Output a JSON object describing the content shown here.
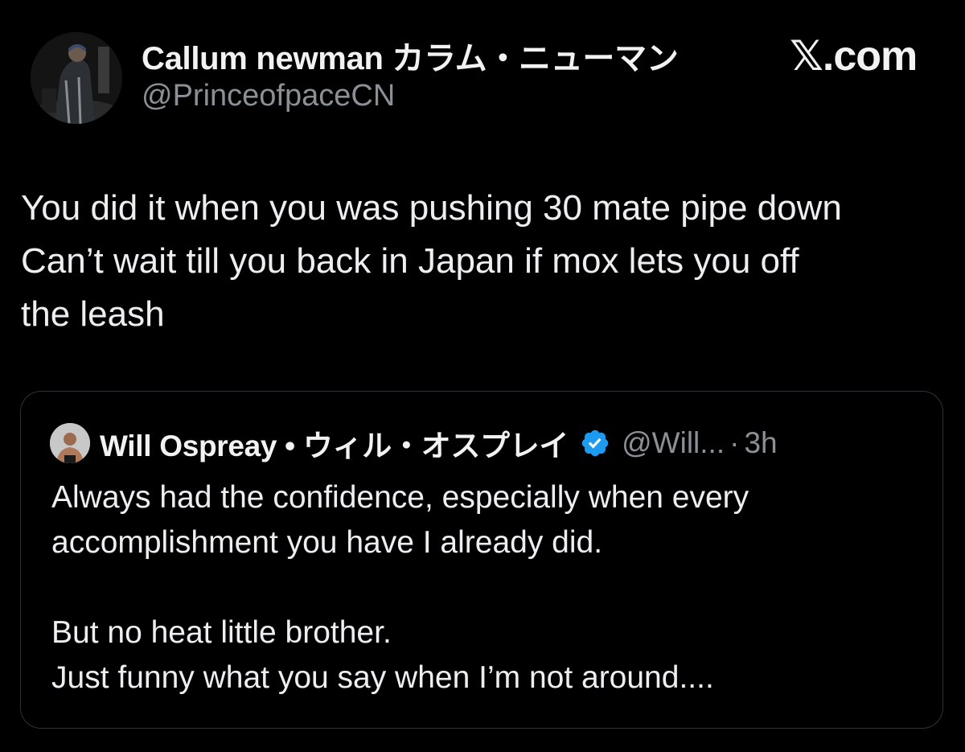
{
  "author": {
    "display_name": "Callum newman カラム・ニューマン",
    "handle": "@PrinceofpaceCN"
  },
  "watermark": {
    "glyph": "𝕏",
    "text": ".com"
  },
  "tweet": {
    "lines": [
      "You did it when you was pushing 30 mate pipe down",
      "Can’t wait till you back in Japan if mox lets you off",
      "the leash"
    ]
  },
  "quoted_tweet": {
    "display_name": "Will Ospreay • ウィル・オスプレイ",
    "verified": true,
    "handle": "@Will...",
    "separator": "·",
    "time": "3h",
    "lines": [
      "Always had the confidence, especially when every",
      "accomplishment you have I already did.",
      "",
      "But no heat little brother.",
      "Just funny what you say when I’m not around...."
    ]
  },
  "colors": {
    "background": "#000000",
    "text_primary": "#e7e9ea",
    "text_secondary": "#8b9096",
    "verified_badge": "#1d9bf0",
    "card_border": "#2f3336"
  },
  "icons": {
    "verified": "verified-badge-icon"
  }
}
